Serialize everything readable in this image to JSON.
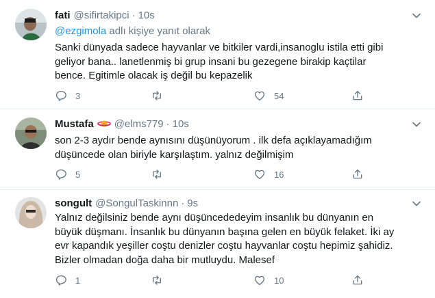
{
  "tweets": [
    {
      "name": "fati",
      "handle": "@sifirtakipci",
      "dot": "·",
      "time": "10s",
      "reply_mention": "@ezgimola",
      "reply_suffix": " adlı kişiye yanıt olarak",
      "text_lines": [
        "Sanki dünyada sadece hayvanlar ve bitkiler vardi,insanoglu istila etti gibi",
        "geliyor bana.. lanetlenmiş bi grup insani bu gezegene birakip kaçtilar",
        "bence. Egitimle olacak iş değil bu kepazelik"
      ],
      "replies": "3",
      "retweets": "",
      "likes": "54"
    },
    {
      "name": "Mustafa",
      "badge_icon": "planet-emoji-icon",
      "handle": "@elms779",
      "dot": "·",
      "time": "10s",
      "text_lines": [
        "son 2-3 aydır bende aynısını düşünüyorum . ilk defa açıklayamadığım",
        "düşüncede olan biriyle karşılaştım. yalnız değilmişim"
      ],
      "replies": "5",
      "retweets": "",
      "likes": "16"
    },
    {
      "name": "songult",
      "handle": "@SongulTaskinnn",
      "dot": "·",
      "time": "9s",
      "text_lines": [
        "Yalnız değilsiniz bende aynı düşüncededeyim insanlık bu dünyanın en",
        "büyük düşmanı. İnsanlık bu dünyanın başına gelen en büyük felaket. İki ay",
        "evr kapandık yeşiller coştu denizler coştu hayvanlar coştu hepimiz şahidiz.",
        "Bizler olmadan doğa daha bir mutluydu. Malesef"
      ],
      "replies": "1",
      "retweets": "",
      "likes": "10"
    }
  ],
  "colors": {
    "text": "#14171a",
    "muted": "#657786",
    "link": "#1b95e0",
    "divider": "#e6ecf0"
  }
}
